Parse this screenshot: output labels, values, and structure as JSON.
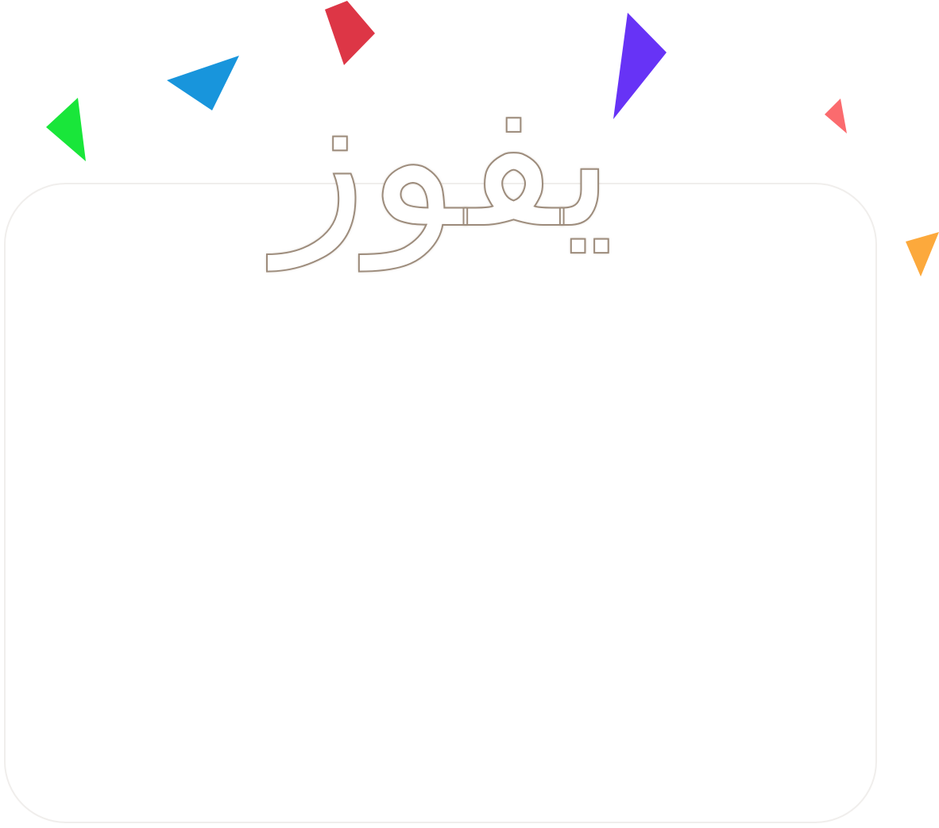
{
  "win_screen": {
    "title": "يفوز"
  },
  "confetti": [
    {
      "name": "confetti-green",
      "color": "#19e63a"
    },
    {
      "name": "confetti-blue",
      "color": "#1895dc"
    },
    {
      "name": "confetti-red",
      "color": "#dd3646"
    },
    {
      "name": "confetti-purple",
      "color": "#6733f6"
    },
    {
      "name": "confetti-coral",
      "color": "#fb6b6e"
    },
    {
      "name": "confetti-orange",
      "color": "#fca93c"
    }
  ]
}
